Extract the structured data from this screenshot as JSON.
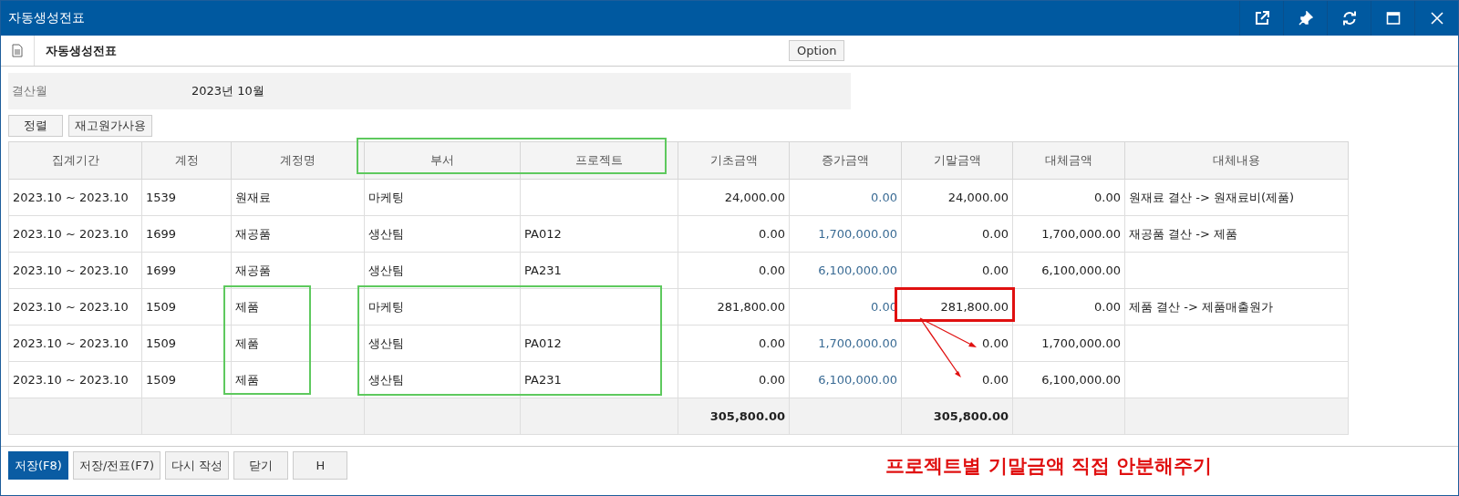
{
  "window": {
    "title": "자동생성전표"
  },
  "toolbar": {
    "title": "자동생성전표",
    "option_button": "Option"
  },
  "form": {
    "label": "결산월",
    "value": "2023년 10월"
  },
  "top_buttons": [
    "정렬",
    "재고원가사용"
  ],
  "table": {
    "columns": [
      "집계기간",
      "계정",
      "계정명",
      "부서",
      "프로젝트",
      "기초금액",
      "증가금액",
      "기말금액",
      "대체금액",
      "대체내용"
    ],
    "rows": [
      {
        "period": "2023.10 ~ 2023.10",
        "account": "1539",
        "account_name": "원재료",
        "department": "마케팅",
        "opening": "24,000.00",
        "increase": "0.00",
        "closing": "24,000.00",
        "transfer": "0.00",
        "transfer_note": "원재료 결산 -> 원재료비(제품)"
      },
      {
        "period": "2023.10 ~ 2023.10",
        "account": "1699",
        "account_name": "재공품",
        "department": "생산팀",
        "project": "PA012",
        "opening": "0.00",
        "increase": "1,700,000.00",
        "closing": "0.00",
        "transfer": "1,700,000.00",
        "transfer_note": "재공품 결산 -> 제품"
      },
      {
        "period": "2023.10 ~ 2023.10",
        "account": "1699",
        "account_name": "재공품",
        "department": "생산팀",
        "project": "PA231",
        "opening": "0.00",
        "increase": "6,100,000.00",
        "closing": "0.00",
        "transfer": "6,100,000.00"
      },
      {
        "period": "2023.10 ~ 2023.10",
        "account": "1509",
        "account_name": "제품",
        "department": "마케팅",
        "opening": "281,800.00",
        "increase": "0.00",
        "closing": "281,800.00",
        "transfer": "0.00",
        "transfer_note": "제품 결산 -> 제품매출원가"
      },
      {
        "period": "2023.10 ~ 2023.10",
        "account": "1509",
        "account_name": "제품",
        "department": "생산팀",
        "project": "PA012",
        "opening": "0.00",
        "increase": "1,700,000.00",
        "closing": "0.00",
        "transfer": "1,700,000.00"
      },
      {
        "period": "2023.10 ~ 2023.10",
        "account": "1509",
        "account_name": "제품",
        "department": "생산팀",
        "project": "PA231",
        "opening": "0.00",
        "increase": "6,100,000.00",
        "closing": "0.00",
        "transfer": "6,100,000.00"
      }
    ],
    "totals": {
      "opening": "305,800.00",
      "closing": "305,800.00"
    }
  },
  "bottom_buttons": [
    {
      "label": "저장(F8)",
      "primary": true
    },
    {
      "label": "저장/전표(F7)",
      "primary": false
    },
    {
      "label": "다시 작성",
      "primary": false
    },
    {
      "label": "닫기",
      "primary": false
    },
    {
      "label": "H",
      "primary": false
    }
  ],
  "annotation": "프로젝트별 기말금액 직접 안분해주기"
}
